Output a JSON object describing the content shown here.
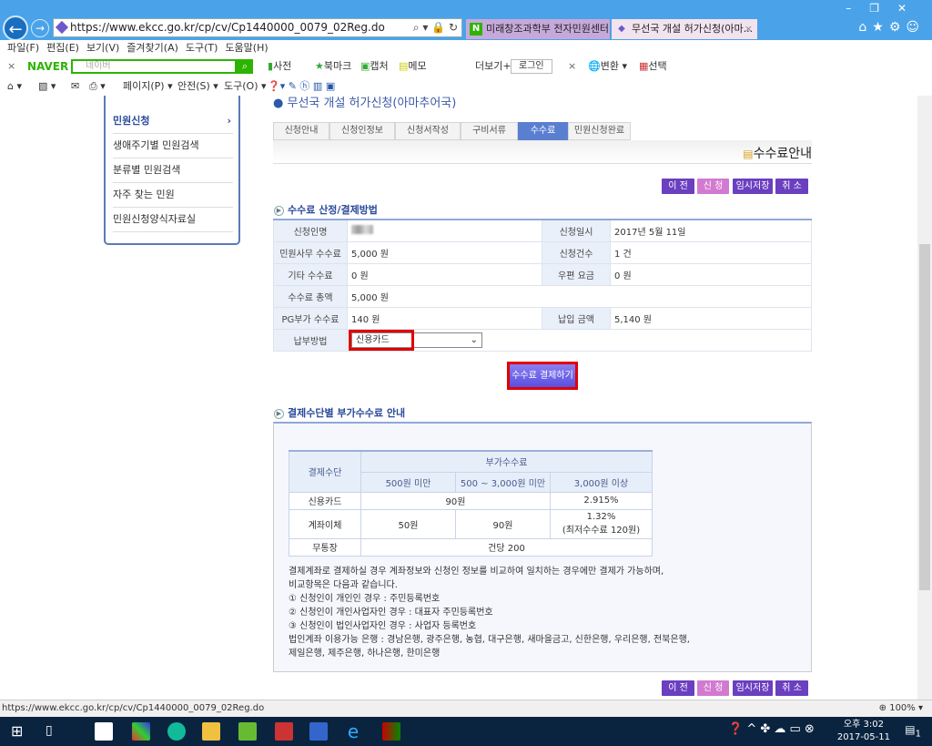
{
  "browser": {
    "url": "https://www.ekcc.go.kr/cp/cv/Cp1440000_0079_02Reg.do",
    "tabs": [
      {
        "label": "미래창조과학부 전자민원센터..."
      },
      {
        "label": "무선국 개설 허가신청(아마..."
      }
    ],
    "menu": [
      "파일(F)",
      "편집(E)",
      "보기(V)",
      "즐겨찾기(A)",
      "도구(T)",
      "도움말(H)"
    ],
    "naver": {
      "logo": "NAVER",
      "placeholder": "네이버",
      "items": [
        "사전",
        "북마크",
        "캡처",
        "메모"
      ],
      "more": "더보기+",
      "login": "로그인",
      "translate": "변환",
      "select": "선택"
    },
    "cmd": [
      "페이지(P)",
      "안전(S)",
      "도구(O)"
    ],
    "status_url": "https://www.ekcc.go.kr/cp/cv/Cp1440000_0079_02Reg.do",
    "zoom": "100%"
  },
  "sidebar": {
    "items": [
      "민원신청",
      "생애주기별 민원검색",
      "분류별 민원검색",
      "자주 찾는 민원",
      "민원신청양식자료실"
    ]
  },
  "page": {
    "title": "무선국 개설 허가신청(아마추어국)",
    "steps": [
      "신청안내",
      "신청인정보",
      "신청서작성",
      "구비서류",
      "수수료",
      "민원신청완료"
    ],
    "active_step": 4,
    "section_title": "수수료안내",
    "buttons": {
      "prev": "이 전",
      "apply": "신 청",
      "save": "임시저장",
      "cancel": "취 소"
    },
    "fee_heading": "수수료 산정/결제방법",
    "fee": {
      "applicant_label": "신청인명",
      "date_label": "신청일시",
      "date": "2017년 5월 11일",
      "office_fee_label": "민원사무 수수료",
      "office_fee": "5,000 원",
      "count_label": "신청건수",
      "count": "1 건",
      "other_fee_label": "기타 수수료",
      "other_fee": "0 원",
      "postal_label": "우편 요금",
      "postal": "0 원",
      "total_label": "수수료 총액",
      "total": "5,000 원",
      "pg_label": "PG부가 수수료",
      "pg": "140 원",
      "pay_amount_label": "납입 금액",
      "pay_amount": "5,140 원",
      "method_label": "납부방법",
      "method": "신용카드"
    },
    "pay_button": "수수료 결제하기",
    "guide_heading": "결제수단별 부가수수료 안내",
    "guide_table": {
      "h_method": "결제수단",
      "h_fee": "부가수수료",
      "h_cols": [
        "500원 미만",
        "500 ~ 3,000원 미만",
        "3,000원 이상"
      ],
      "card": {
        "name": "신용카드",
        "low": "90원",
        "high": "2.915%"
      },
      "transfer": {
        "name": "계좌이체",
        "c1": "50원",
        "c2": "90원",
        "c3a": "1.32%",
        "c3b": "(최저수수료 120원)"
      },
      "bank": {
        "name": "무통장",
        "fee": "건당 200"
      }
    },
    "notes": [
      "결제계좌로 결제하실 경우 계좌정보와 신청인 정보를 비교하여 일치하는 경우에만 결제가 가능하며,",
      "비교항목은 다음과 같습니다.",
      "① 신청인이 개인인 경우 : 주민등록번호",
      "② 신청인이 개인사업자인 경우 : 대표자 주민등록번호",
      "③ 신청인이 법인사업자인 경우 : 사업자 등록번호",
      "법인계좌 이용가능 은행 : 경남은행, 광주은행, 농협, 대구은행, 새마을금고, 신한은행, 우리은행, 전북은행,",
      "제일은행, 제주은행, 하나은행, 한미은행"
    ]
  },
  "taskbar": {
    "time": "오후 3:02",
    "date": "2017-05-11",
    "notif": "1"
  },
  "colors": {
    "accent": "#6a3fc0",
    "highlight": "#e00000",
    "step_active": "#5b7fd0"
  }
}
